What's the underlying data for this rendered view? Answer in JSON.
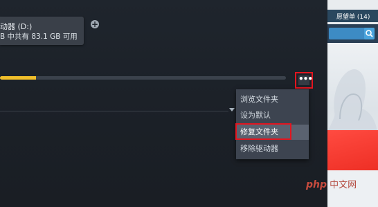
{
  "drive": {
    "name": "动器 (D:)",
    "space": "B 中共有 83.1 GB 可用"
  },
  "add_button": {
    "icon": "plus-circle-icon",
    "label": "+"
  },
  "storage_usage": {
    "used_fraction": 0.126,
    "color_used": "#f1bf2b"
  },
  "more_button": {
    "label": "•••",
    "highlight_color": "#e3151f"
  },
  "context_menu": {
    "items": [
      {
        "label": "浏览文件夹"
      },
      {
        "label": "设为默认"
      },
      {
        "label": "修复文件夹",
        "highlighted": true
      },
      {
        "label": "移除驱动器"
      }
    ]
  },
  "side_panel": {
    "wishlist_label": "愿望单 (14)",
    "search_icon": "search-icon"
  },
  "watermark": {
    "brand": "php",
    "text": "中文网"
  }
}
